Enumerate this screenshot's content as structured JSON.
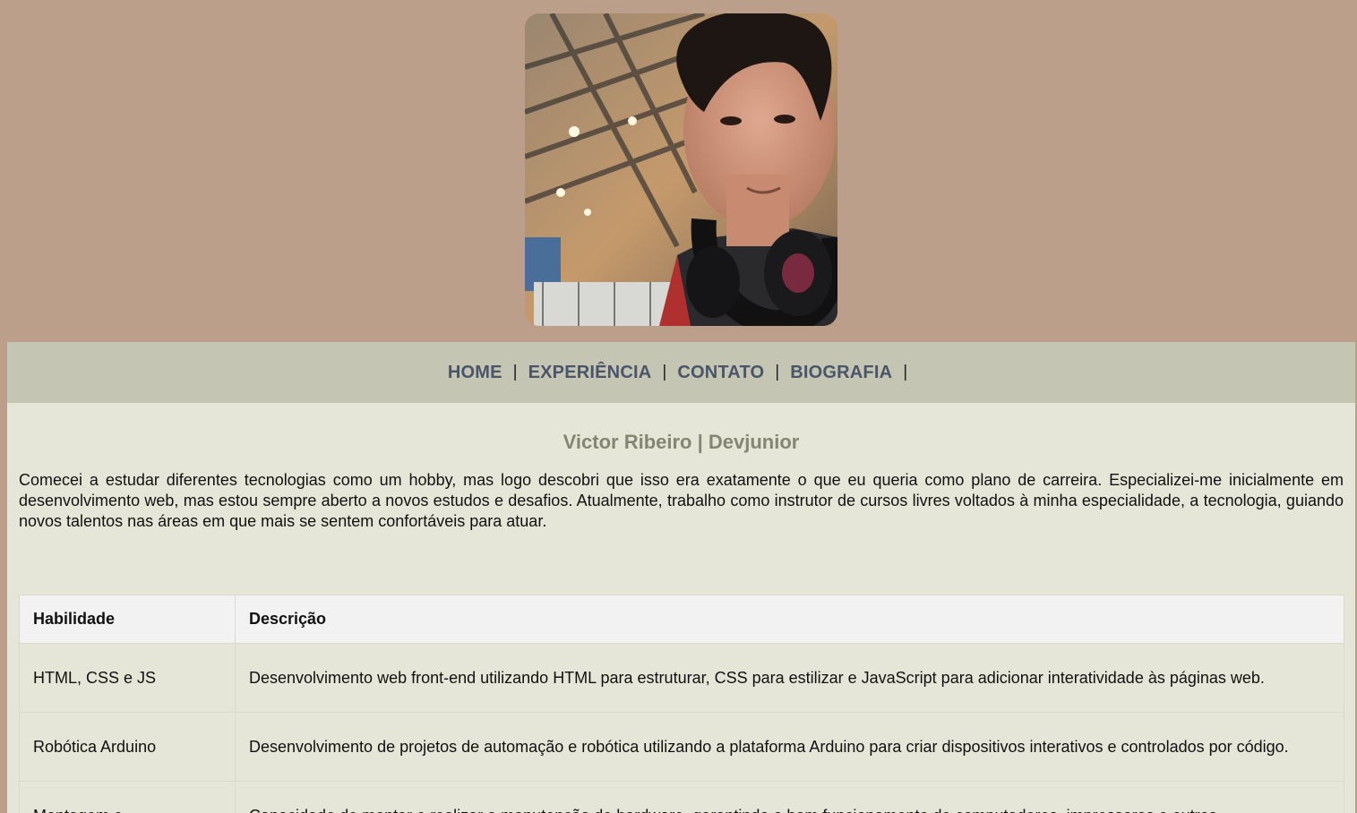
{
  "profile": {
    "photo_alt": "Foto de Victor Ribeiro"
  },
  "nav": {
    "items": [
      {
        "label": "HOME"
      },
      {
        "label": "EXPERIÊNCIA"
      },
      {
        "label": "CONTATO"
      },
      {
        "label": "BIOGRAFIA"
      }
    ],
    "separator": "|"
  },
  "heading": "Victor Ribeiro | Devjunior",
  "bio": "Comecei a estudar diferentes tecnologias como um hobby, mas logo descobri que isso era exatamente o que eu queria como plano de carreira. Especializei-me inicialmente em desenvolvimento web, mas estou sempre aberto a novos estudos e desafios. Atualmente, trabalho como instrutor de cursos livres voltados à minha especialidade, a tecnologia, guiando novos talentos nas áreas em que mais se sentem confortáveis para atuar.",
  "skills_table": {
    "headers": [
      "Habilidade",
      "Descrição"
    ],
    "rows": [
      {
        "skill": "HTML, CSS e JS",
        "description": "Desenvolvimento web front-end utilizando HTML para estruturar, CSS para estilizar e JavaScript para adicionar interatividade às páginas web."
      },
      {
        "skill": "Robótica Arduino",
        "description": "Desenvolvimento de projetos de automação e robótica utilizando a plataforma Arduino para criar dispositivos interativos e controlados por código."
      },
      {
        "skill": "Montagem e",
        "description": "Capacidade de montar e realizar a manutenção de hardware, garantindo o bom funcionamento de computadores, impressoras e outros"
      }
    ]
  },
  "colors": {
    "outer_background": "#bb9f8b",
    "page_background": "#e6e6d8",
    "nav_background": "#c5c5b3",
    "nav_link": "#4a5568",
    "heading": "#858573"
  }
}
